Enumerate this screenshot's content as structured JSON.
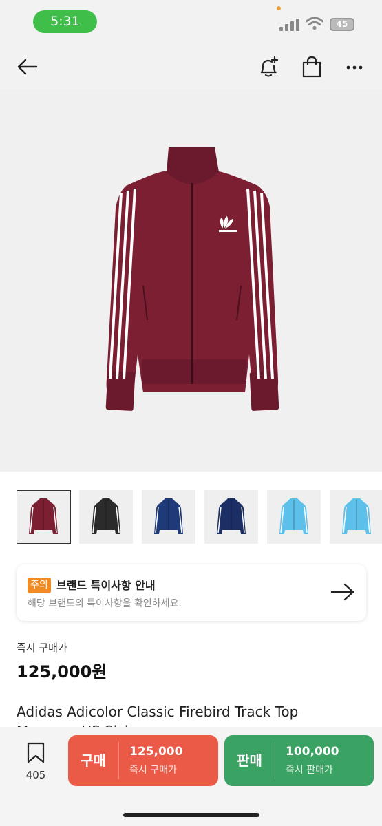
{
  "status_bar": {
    "time": "5:31",
    "battery": "45"
  },
  "nav": {
    "back_icon": "back-arrow-icon",
    "bell_icon": "bell-plus-icon",
    "bag_icon": "shopping-bag-icon",
    "more_icon": "more-icon"
  },
  "product": {
    "jacket_color": "#7c1f33",
    "thumbnails": [
      {
        "color": "#7c1f33",
        "selected": true
      },
      {
        "color": "#2b2b2b",
        "selected": false
      },
      {
        "color": "#1f3a78",
        "selected": false
      },
      {
        "color": "#1c2e66",
        "selected": false
      },
      {
        "color": "#5cc0ea",
        "selected": false
      },
      {
        "color": "#5cc0ea",
        "selected": false
      }
    ]
  },
  "notice": {
    "tag": "주의",
    "title": "브랜드 특이사항 안내",
    "subtitle": "해당 브랜드의 특이사항을 확인하세요."
  },
  "price": {
    "label": "즉시 구매가",
    "value": "125,000원"
  },
  "product_name": {
    "line1": "Adidas Adicolor Classic Firebird Track Top",
    "line2": "Maroon - US Sizing"
  },
  "bottom_bar": {
    "wish_count": "405",
    "buy": {
      "label": "구매",
      "price": "125,000",
      "sub": "즉시 구매가"
    },
    "sell": {
      "label": "판매",
      "price": "100,000",
      "sub": "즉시 판매가"
    }
  },
  "colors": {
    "buy": "#ea5a47",
    "sell": "#3aa262",
    "notice_tag": "#f08a24",
    "time_pill": "#3fbf4a"
  }
}
